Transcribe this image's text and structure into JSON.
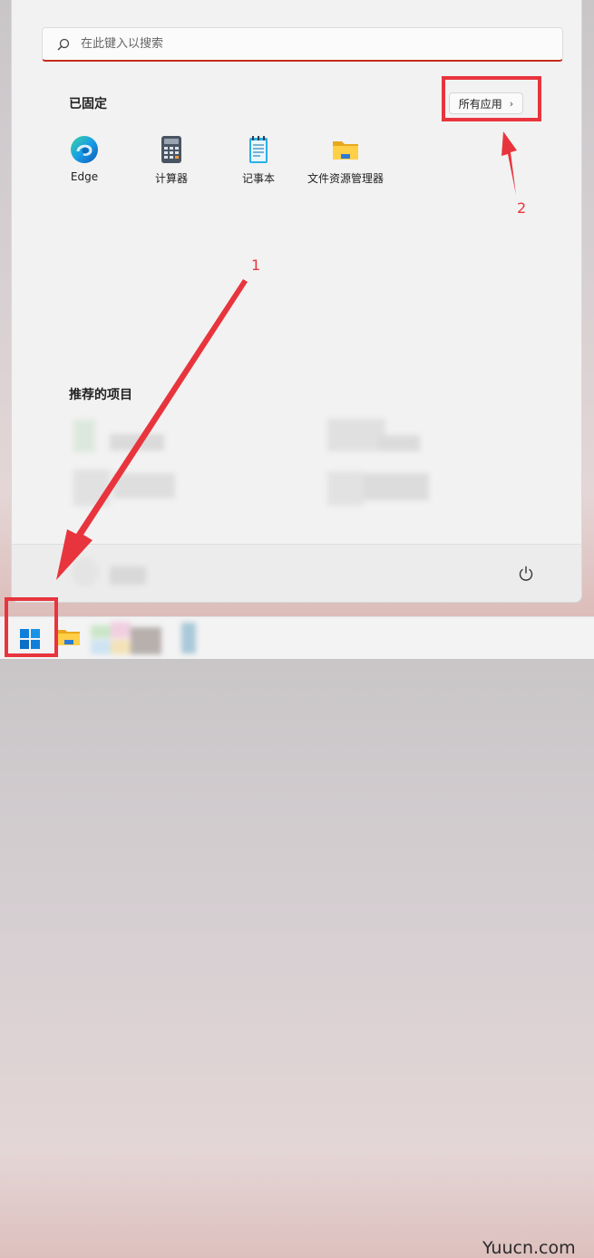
{
  "search": {
    "placeholder": "在此键入以搜索"
  },
  "pinned": {
    "title": "已固定",
    "all_apps_label": "所有应用",
    "apps": [
      {
        "label": "Edge",
        "icon": "edge-icon"
      },
      {
        "label": "计算器",
        "icon": "calculator-icon"
      },
      {
        "label": "记事本",
        "icon": "notepad-icon"
      },
      {
        "label": "文件资源管理器",
        "icon": "folder-icon"
      }
    ]
  },
  "recommended": {
    "title": "推荐的项目"
  },
  "annotations": {
    "marker_1": "1",
    "marker_2": "2"
  },
  "watermark": "Yuucn.com",
  "colors": {
    "highlight": "#e8353d",
    "accent": "#c42b1c",
    "start_blue": "#0f7fd9"
  }
}
